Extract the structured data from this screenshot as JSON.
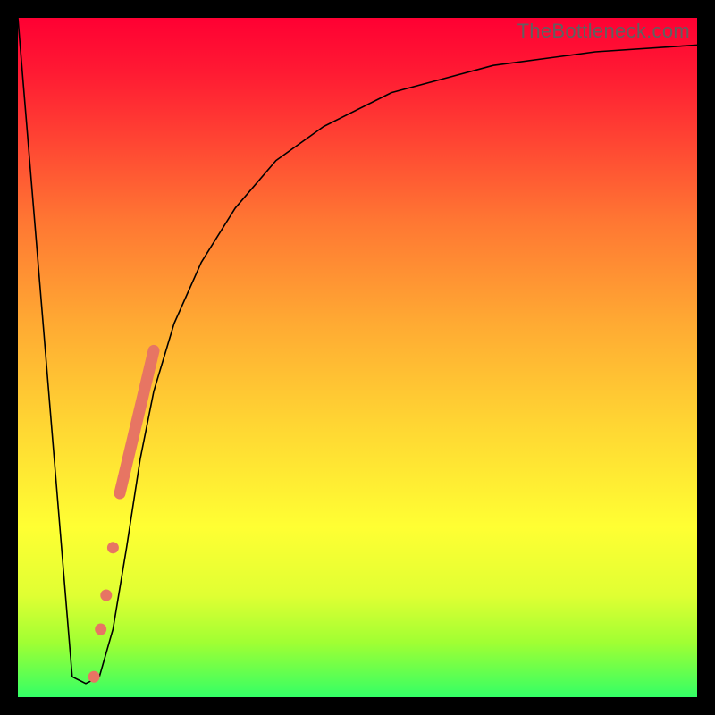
{
  "watermark": "TheBottleneck.com",
  "colors": {
    "frame": "#000000",
    "gradient_top": "#ff0033",
    "gradient_mid": "#ffff33",
    "gradient_bottom": "#33ff66",
    "curve": "#000000",
    "highlight": "#e77563"
  },
  "chart_data": {
    "type": "line",
    "title": "",
    "xlabel": "",
    "ylabel": "",
    "xlim": [
      0,
      100
    ],
    "ylim": [
      0,
      100
    ],
    "series": [
      {
        "name": "bottleneck-curve",
        "x": [
          0,
          8,
          10,
          12,
          14,
          16,
          18,
          20,
          23,
          27,
          32,
          38,
          45,
          55,
          70,
          85,
          100
        ],
        "y": [
          100,
          3,
          2,
          3,
          10,
          22,
          35,
          45,
          55,
          64,
          72,
          79,
          84,
          89,
          93,
          95,
          96
        ]
      }
    ],
    "highlight_segment": {
      "x": [
        15,
        20
      ],
      "y": [
        30,
        51
      ]
    },
    "highlight_dots": [
      {
        "x": 14.0,
        "y": 22
      },
      {
        "x": 13.0,
        "y": 15
      },
      {
        "x": 12.2,
        "y": 10
      },
      {
        "x": 11.2,
        "y": 3
      }
    ],
    "annotations": []
  }
}
